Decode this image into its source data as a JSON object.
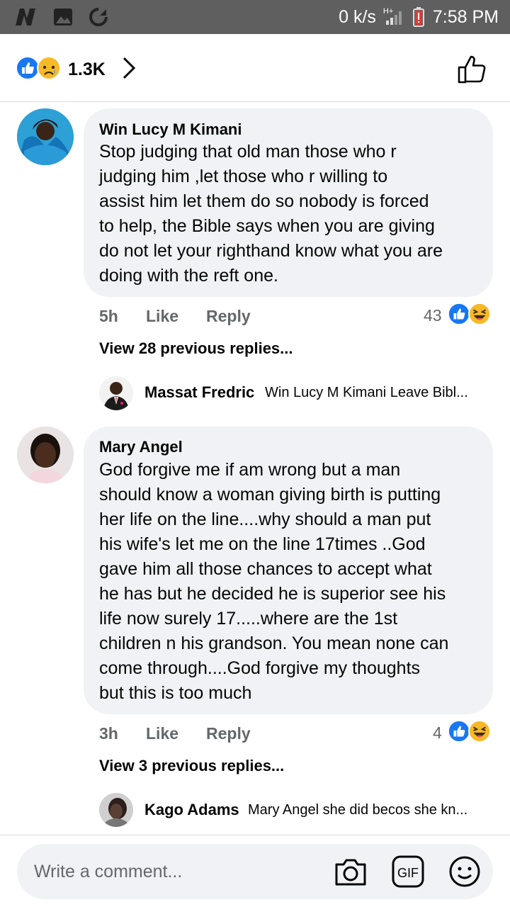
{
  "status_bar": {
    "speed": "0 k/s",
    "network": "H+",
    "time": "7:58 PM"
  },
  "header": {
    "reaction_count": "1.3K",
    "reactions": [
      "like-icon",
      "sad-icon"
    ]
  },
  "comments": [
    {
      "author": "Win Lucy M Kimani",
      "lines": [
        "Stop judging that old man those who r",
        "judging him ,let those who  r willing to",
        "assist him let them do so nobody is forced",
        "to help, the Bible says when you are giving",
        "do not let your righthand know what you are",
        "doing with the reft one."
      ],
      "time": "5h",
      "like_label": "Like",
      "reply_label": "Reply",
      "reaction_count": "43",
      "view_replies": "View 28 previous replies...",
      "reply": {
        "author": "Massat Fredric",
        "preview": "Win Lucy M Kimani Leave Bibl..."
      }
    },
    {
      "author": "Mary Angel",
      "lines": [
        "God forgive me if am wrong but a man",
        "should know a woman giving birth is putting",
        "her life on the line....why should a man put",
        "his wife's let me on the line 17times ..God",
        "gave him all those chances to accept what",
        "he has but he decided he is superior see his",
        "life now surely 17.....where are the 1st",
        "children n his grandson. You mean none can",
        "come through....God forgive my thoughts",
        "but this is too much"
      ],
      "time": "3h",
      "like_label": "Like",
      "reply_label": "Reply",
      "reaction_count": "4",
      "view_replies": "View 3 previous replies...",
      "reply": {
        "author": "Kago Adams",
        "preview": "Mary Angel she did becos she kn..."
      }
    }
  ],
  "composer": {
    "placeholder": "Write a comment...",
    "icons": [
      "camera-icon",
      "gif-icon",
      "emoji-icon"
    ]
  },
  "colors": {
    "like_blue": "#1877f2",
    "haha_yellow": "#f7b928",
    "bubble_bg": "#f0f2f5",
    "meta_gray": "#65676b"
  }
}
